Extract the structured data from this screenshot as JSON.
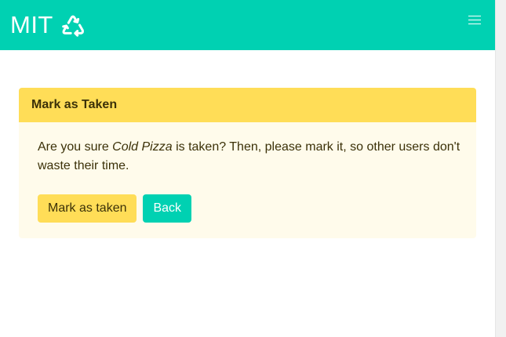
{
  "navbar": {
    "brand_text": "MIT",
    "logo_icon": "recycle-icon",
    "menu_icon": "hamburger-icon",
    "color": "#00d1b2"
  },
  "message": {
    "title": "Mark as Taken",
    "body_prefix": "Are you sure ",
    "item_name": "Cold Pizza",
    "body_suffix": " is taken? Then, please mark it, so other users don't waste their time.",
    "header_color": "#ffdd57",
    "body_bg": "#fffbeb"
  },
  "actions": {
    "mark_label": "Mark as taken",
    "back_label": "Back"
  }
}
